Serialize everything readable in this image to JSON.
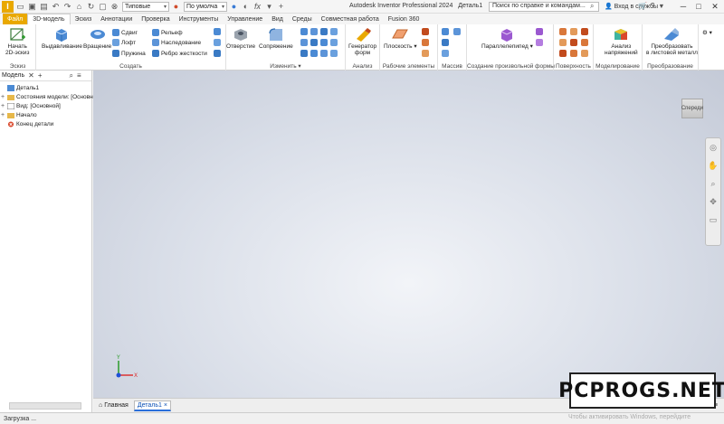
{
  "title_bar": {
    "app_logo": "I",
    "appearance_combo": "Типовые",
    "material_combo": "По умолча",
    "fx_label": "fx",
    "window_title": "Autodesk Inventor Professional 2024",
    "document_name": "Деталь1",
    "help_search_placeholder": "Поиск по справке и командам...",
    "signin_label": "Вход в службы",
    "minimize": "─",
    "maximize": "□",
    "close": "✕"
  },
  "ribbon_tabs": [
    {
      "label": "Файл"
    },
    {
      "label": "3D-модель"
    },
    {
      "label": "Эскиз"
    },
    {
      "label": "Аннотации"
    },
    {
      "label": "Проверка"
    },
    {
      "label": "Инструменты"
    },
    {
      "label": "Управление"
    },
    {
      "label": "Вид"
    },
    {
      "label": "Среды"
    },
    {
      "label": "Совместная работа"
    },
    {
      "label": "Fusion 360"
    }
  ],
  "ribbon": {
    "sketch": {
      "group": "Эскиз",
      "start_sketch": "Начать\n2D-эскиз"
    },
    "create": {
      "group": "Создать",
      "extrude": "Выдавливание",
      "revolve": "Вращение",
      "sweep": "Сдвиг",
      "loft": "Лофт",
      "coil": "Пружина",
      "emboss": "Рельеф",
      "derive": "Наследование",
      "rib": "Ребро жесткости"
    },
    "modify": {
      "group": "Изменить",
      "hole": "Отверстие",
      "fillet": "Сопряжение"
    },
    "explore": {
      "group": "Анализ",
      "frame_generator": "Генератор\nформ"
    },
    "work_features": {
      "group": "Рабочие элементы",
      "plane": "Плоскость"
    },
    "pattern": {
      "group": "Массив"
    },
    "freeform": {
      "group": "Создание произвольной формы",
      "box": "Параллелепипед"
    },
    "surface": {
      "group": "Поверхность"
    },
    "simulation": {
      "group": "Моделирование",
      "stress": "Анализ\nнапряжений"
    },
    "convert": {
      "group": "Преобразование",
      "sheet_metal": "Преобразовать\nв листовой металл"
    }
  },
  "browser": {
    "tab_label": "Модель",
    "tree": [
      {
        "label": "Деталь1"
      },
      {
        "label": "Состояния модели: [Основной]"
      },
      {
        "label": "Вид: [Основной]"
      },
      {
        "label": "Начало"
      },
      {
        "label": "Конец детали"
      }
    ]
  },
  "viewport": {
    "viewcube_label": "Спереди",
    "triad": {
      "x": "X",
      "y": "Y"
    }
  },
  "document_tabs": [
    {
      "label": "Главная"
    },
    {
      "label": "Деталь1"
    }
  ],
  "status_bar": {
    "text": "Загрузка ...",
    "activate_windows": "Чтобы активировать Windows, перейдите"
  },
  "watermark": "PCPROGS.NET",
  "colors": {
    "accent": "#e9a800",
    "viewport_center": "#f2f4f8",
    "viewport_edge": "#c4cad7",
    "active_tab": "#2a6fdb"
  }
}
